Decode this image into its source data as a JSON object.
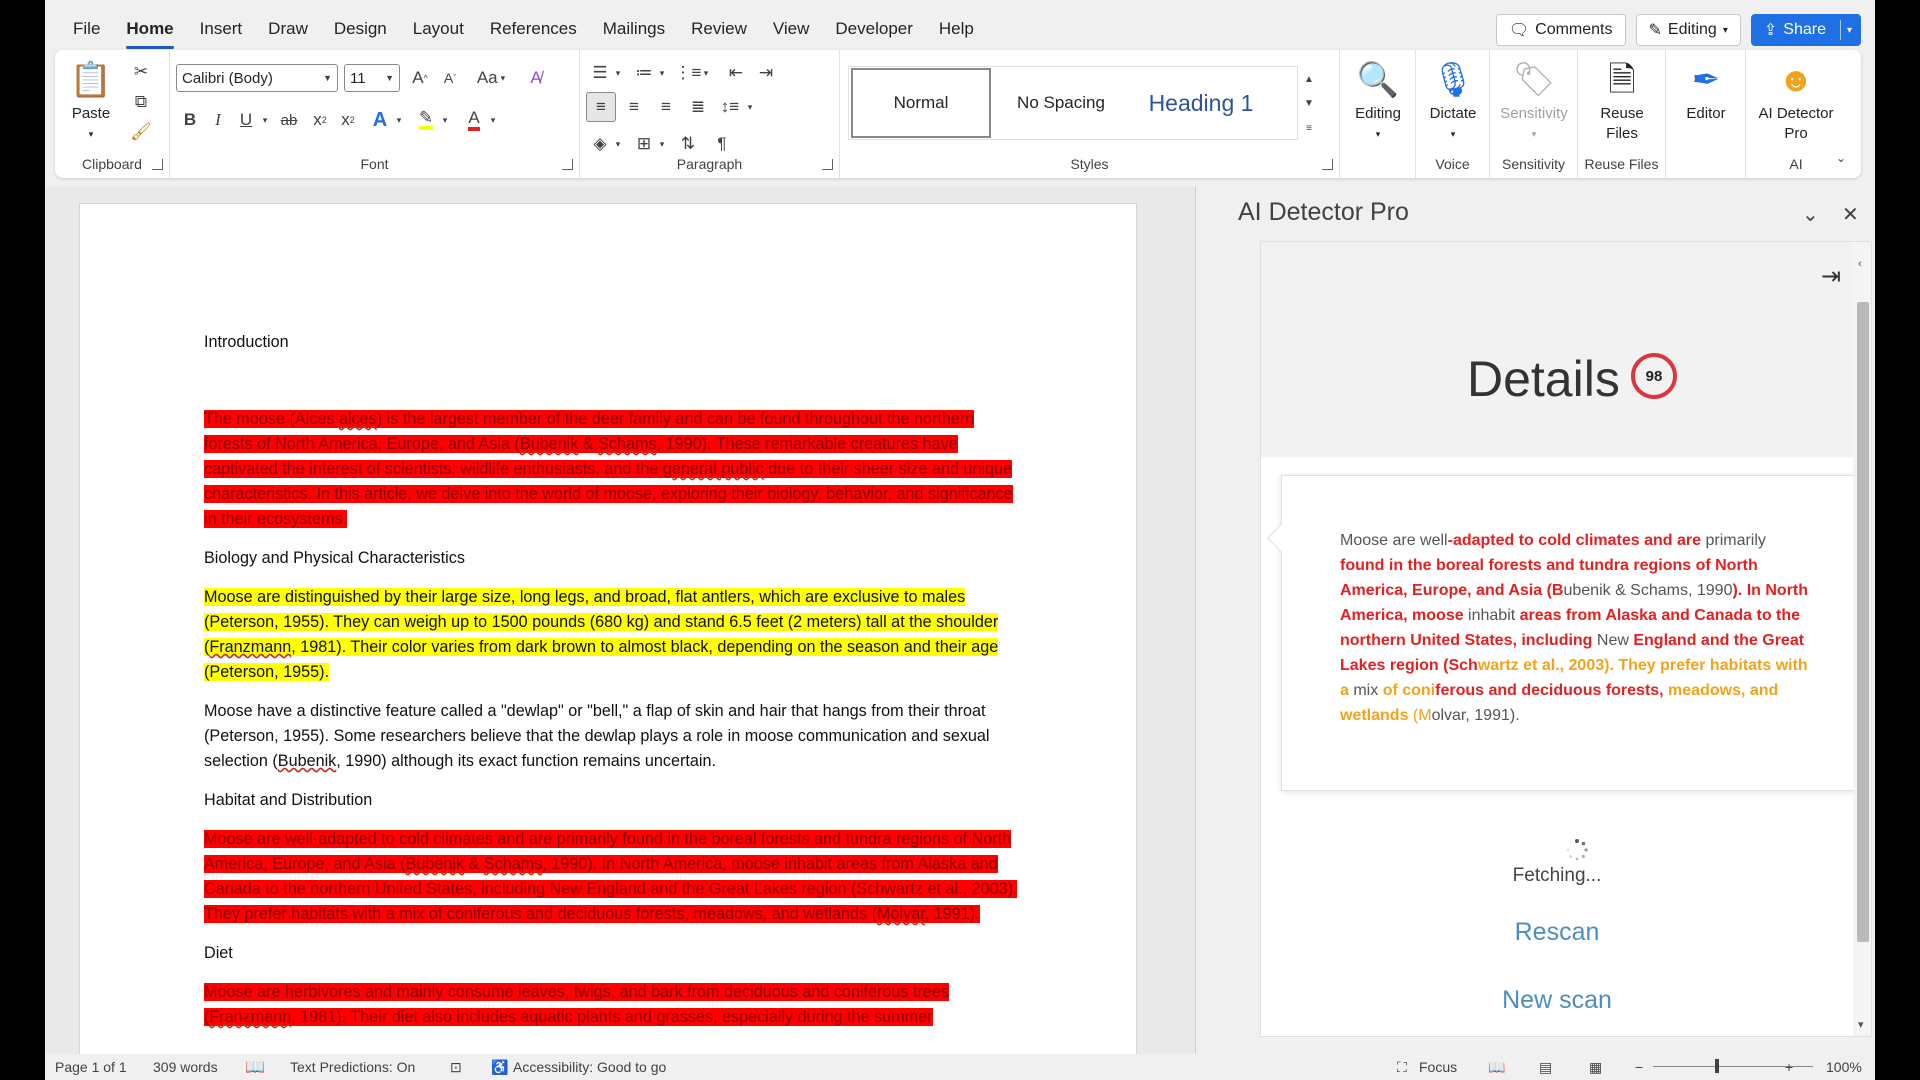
{
  "menu": {
    "tabs": [
      "File",
      "Home",
      "Insert",
      "Draw",
      "Design",
      "Layout",
      "References",
      "Mailings",
      "Review",
      "View",
      "Developer",
      "Help"
    ],
    "active_tab": "Home",
    "comments_label": "Comments",
    "editing_label": "Editing",
    "share_label": "Share"
  },
  "ribbon": {
    "clipboard": {
      "paste_label": "Paste",
      "group_label": "Clipboard"
    },
    "font": {
      "font_name": "Calibri (Body)",
      "font_size": "11",
      "group_label": "Font",
      "grow_label": "A",
      "shrink_label": "A",
      "case_label": "Aa",
      "bold": "B",
      "italic": "I",
      "underline": "U",
      "strike": "ab",
      "subscript": "x",
      "superscript": "x",
      "effects": "A",
      "font_color": "A"
    },
    "paragraph": {
      "group_label": "Paragraph"
    },
    "styles": {
      "items": [
        "Normal",
        "No Spacing",
        "Heading 1"
      ],
      "group_label": "Styles"
    },
    "editing": {
      "label": "Editing"
    },
    "voice": {
      "dictate_label": "Dictate",
      "group_label": "Voice"
    },
    "sensitivity": {
      "label": "Sensitivity",
      "group_label": "Sensitivity"
    },
    "reuse": {
      "label_line1": "Reuse",
      "label_line2": "Files",
      "group_label": "Reuse Files"
    },
    "editor": {
      "label": "Editor"
    },
    "ai": {
      "label_line1": "AI Detector",
      "label_line2": "Pro",
      "group_label": "AI"
    }
  },
  "document": {
    "intro_heading": "Introduction",
    "intro_para": {
      "t1": "The moose (Alces ",
      "s1": "alces",
      "t2": ") is the largest member of the deer family and can be found throughout the northern forests of North America, Europe, and Asia (",
      "s2": "Bubenik",
      "t3": " & ",
      "s3": "Schams",
      "t4": ", 1990). These remarkable creatures have captivated the interest of scientists, wildlife enthusiasts, and the ",
      "s4": "general public",
      "t5": " due to their sheer size and unique characteristics. In this article, we delve into the world of moose, exploring their biology, behavior, and significance in their ecosystems."
    },
    "bio_heading": "Biology and Physical Characteristics",
    "bio_para": {
      "t1": "Moose are distinguished by their large size, long legs, and broad, flat antlers, which are exclusive to males (Peterson, 1955). They can weigh up to 1500 pounds (680 kg) and stand 6.5 feet (2 meters) tall at the shoulder (",
      "s1": "Franzmann",
      "t2": ", 1981). Their color varies from dark brown to almost black, depending on the season and their age (Peterson, 1955)."
    },
    "dewlap_para": {
      "t1": "Moose have a distinctive feature  called a \"dewlap\" or \"bell,\" a flap of skin and hair that hangs from their throat (Peterson, 1955). Some researchers believe that the dewlap plays a role in moose  communication and sexual selection (",
      "s1": "Bubenik",
      "t2": ", 1990) although its exact function remains uncertain."
    },
    "habitat_heading": "Habitat and Distribution",
    "habitat_para": {
      "t1": "Moose are well-adapted to cold climates and are primarily found in the boreal forests and tundra regions of North America, Europe, and Asia (",
      "s1": "Bubenik",
      "t2": " & ",
      "s2": "Schams",
      "t3": ", 1990). In North America, moose inhabit areas from Alaska and Canada to the northern United States, including New England and the Great Lakes region (Schwartz et al., 2003). They prefer habitats with a mix of coniferous and deciduous forests, meadows, and wetlands (",
      "s3": "Molvar",
      "t4": ", 1991)."
    },
    "diet_heading": "Diet",
    "diet_para": {
      "t1": "Moose are herbivores and mainly consume leaves, twigs, and bark from deciduous and coniferous trees (",
      "s1": "Franzmann",
      "t2": ", 1981). Their diet also includes aquatic plants and grasses, especially during the summer"
    }
  },
  "pane": {
    "title": "AI Detector Pro",
    "details_title": "Details",
    "score": "98",
    "card": {
      "r1": "Moose are well",
      "r2": "-adapted to cold climates and are",
      "r3": " primarily ",
      "r4": "found in the boreal forests and tundra regions of North America, Europe, and Asia (B",
      "r5": "ubenik & Schams, 1990",
      "r6": "). In North America, moose",
      "r7": " inhabit ",
      "r8": "areas from Alaska and Canada to the northern United States, including",
      "r9": " New ",
      "r10": "England and the Great Lakes region (Sch",
      "r11": "wartz et al., 2003). They prefer habitats with a",
      "r12": " mix ",
      "r13": "of coni",
      "r14": "ferous and deciduous forests,",
      "r15": " meadows, and wetlands",
      "r16": " (M",
      "r17": "olvar, 1991)."
    },
    "fetching": "Fetching...",
    "rescan": "Rescan",
    "new_scan": "New scan"
  },
  "status": {
    "page": "Page 1 of 1",
    "words": "309 words",
    "predictions": "Text Predictions: On",
    "accessibility": "Accessibility: Good to go",
    "focus": "Focus",
    "zoom": "100%"
  },
  "colors": {
    "accent": "#185abd",
    "highlight_red": "#ff0000",
    "highlight_yellow": "#ffff00",
    "score_ring": "#d9363e",
    "link": "#4b8ec0"
  }
}
